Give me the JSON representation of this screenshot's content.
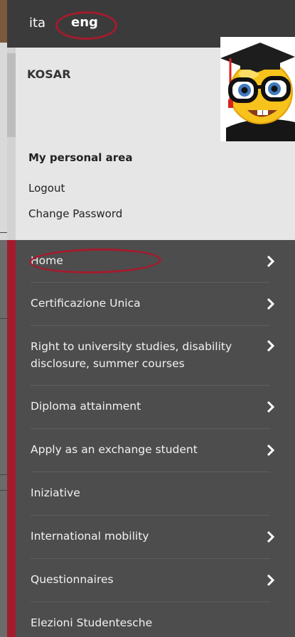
{
  "language": {
    "options": [
      "ita",
      "eng"
    ],
    "selected": "eng"
  },
  "user": {
    "name": "KOSAR",
    "avatar_icon": "nerd-graduate-emoji-icon"
  },
  "personal_area": {
    "title": "My personal area",
    "logout": "Logout",
    "change_password": "Change Password"
  },
  "menu": {
    "items": [
      {
        "label": "Home",
        "has_arrow": true
      },
      {
        "label": "Certificazione Unica",
        "has_arrow": true
      },
      {
        "label": "Right to university studies, disability disclosure, summer courses",
        "line1": "Right to university studies, disability",
        "line2": "disclosure, summer courses",
        "has_arrow": true
      },
      {
        "label": "Diploma attainment",
        "has_arrow": true
      },
      {
        "label": "Apply as an exchange student",
        "has_arrow": true
      },
      {
        "label": "Iniziative",
        "has_arrow": false
      },
      {
        "label": "International mobility",
        "has_arrow": true
      },
      {
        "label": "Questionnaires",
        "has_arrow": true
      },
      {
        "label": "Elezioni Studentesche",
        "has_arrow": false
      }
    ]
  },
  "colors": {
    "accent": "#a41b2d",
    "menu_bg": "#4d4d4d",
    "header_bg": "#3b3b3b",
    "user_area_bg": "#e6e6e6"
  }
}
